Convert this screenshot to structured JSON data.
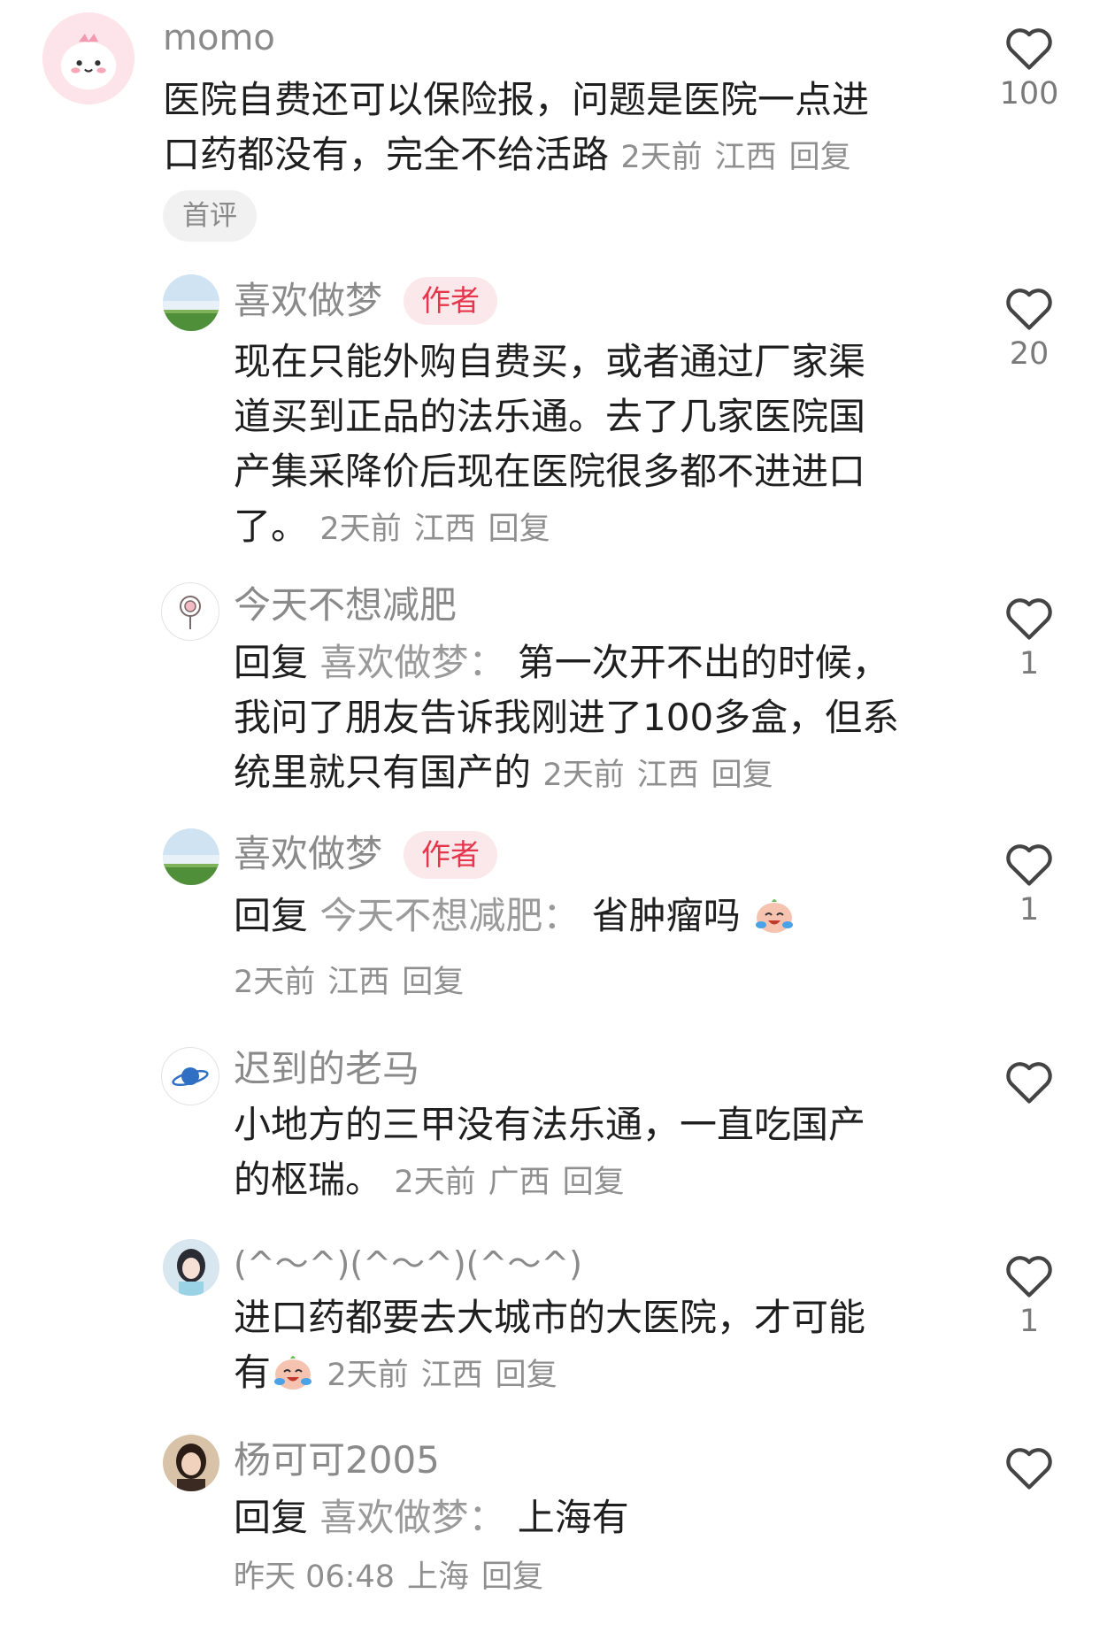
{
  "comments": [
    {
      "username": "momo",
      "lines": [
        "医院自费还可以保险报，问题是医院一点进",
        "口药都没有，完全不给活路"
      ],
      "time": "2天前",
      "location": "江西",
      "reply_label": "回复",
      "badge": "首评",
      "likes": "100",
      "avatar_icon": "pink-cartoon-avatar"
    },
    {
      "username": "喜欢做梦",
      "tag": "作者",
      "lines": [
        "现在只能外购自费买，或者通过厂家渠",
        "道买到正品的法乐通。去了几家医院国",
        "产集采降价后现在医院很多都不进进口",
        "了。"
      ],
      "time": "2天前",
      "location": "江西",
      "reply_label": "回复",
      "likes": "20",
      "avatar_icon": "landscape-avatar"
    },
    {
      "username": "今天不想减肥",
      "reply_prefix": "回复",
      "reply_target": "喜欢做梦：",
      "lines": [
        "第一次开不出的时候，",
        "我问了朋友告诉我刚进了100多盒，但系",
        "统里就只有国产的"
      ],
      "time": "2天前",
      "location": "江西",
      "reply_label": "回复",
      "likes": "1",
      "avatar_icon": "lollipop-avatar"
    },
    {
      "username": "喜欢做梦",
      "tag": "作者",
      "reply_prefix": "回复",
      "reply_target": "今天不想减肥：",
      "lines": [
        "省肿瘤吗"
      ],
      "time": "2天前",
      "location": "江西",
      "reply_label": "回复",
      "likes": "1",
      "avatar_icon": "landscape-avatar"
    },
    {
      "username": "迟到的老马",
      "lines": [
        "小地方的三甲没有法乐通，一直吃国产",
        "的枢瑞。"
      ],
      "time": "2天前",
      "location": "广西",
      "reply_label": "回复",
      "likes": "",
      "avatar_icon": "planet-avatar"
    },
    {
      "username": "(^～^)(^～^)(^～^)",
      "lines": [
        "进口药都要去大城市的大医院，才可能",
        "有"
      ],
      "time": "2天前",
      "location": "江西",
      "reply_label": "回复",
      "likes": "1",
      "avatar_icon": "girl-avatar"
    },
    {
      "username": "杨可可2005",
      "reply_prefix": "回复",
      "reply_target": "喜欢做梦：",
      "lines": [
        "上海有"
      ],
      "time": "昨天 06:48",
      "location": "上海",
      "reply_label": "回复",
      "likes": "",
      "avatar_icon": "woman-photo-avatar"
    }
  ],
  "icons": {
    "like": "heart-outline-icon",
    "emoji": "crying-laughing-emoji"
  },
  "colors": {
    "author_tag_bg": "#fbe8ea",
    "author_tag_text": "#e5364d",
    "meta_text": "#8f8f8f"
  }
}
